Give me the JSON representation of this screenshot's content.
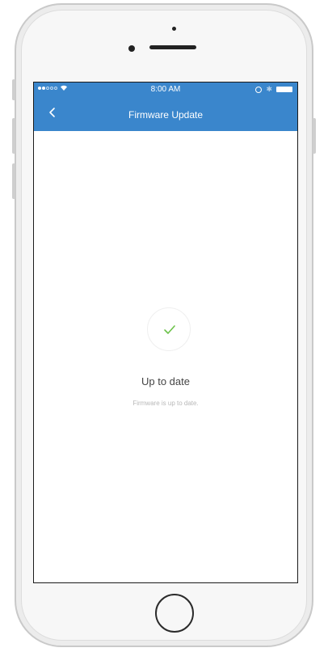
{
  "status_bar": {
    "time": "8:00 AM"
  },
  "header": {
    "title": "Firmware Update",
    "back_icon": "chevron-left-icon",
    "accent_color": "#3a86cc"
  },
  "content": {
    "status_icon": "checkmark-icon",
    "status_icon_color": "#6cc24a",
    "status_title": "Up to date",
    "status_message": "Firmware is up to date."
  }
}
